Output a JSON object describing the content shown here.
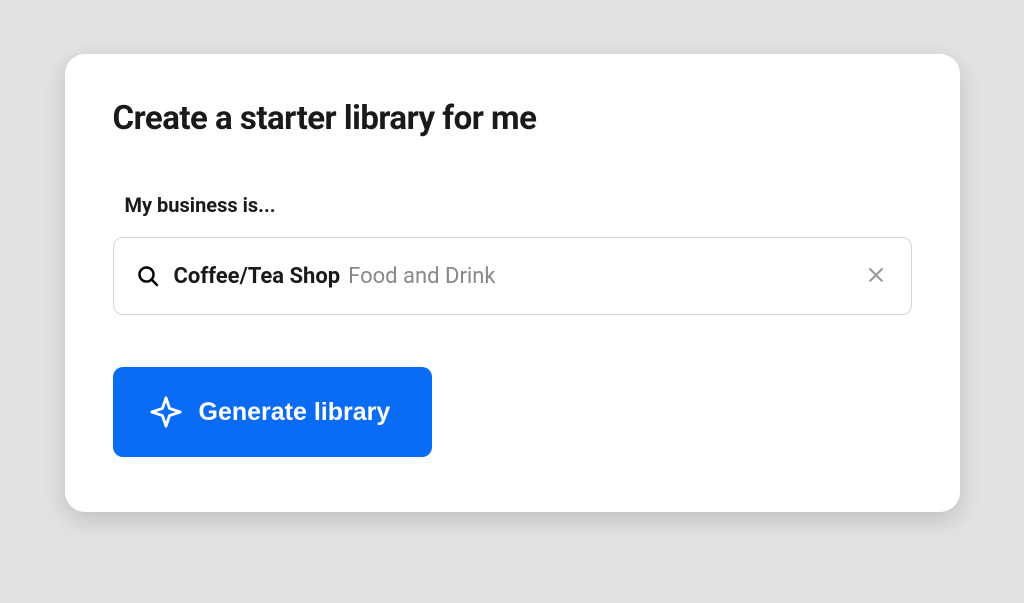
{
  "card": {
    "title": "Create a starter library for me",
    "business_label": "My business is...",
    "input": {
      "value": "Coffee/Tea Shop",
      "category": "Food and Drink"
    },
    "generate_label": "Generate library"
  }
}
